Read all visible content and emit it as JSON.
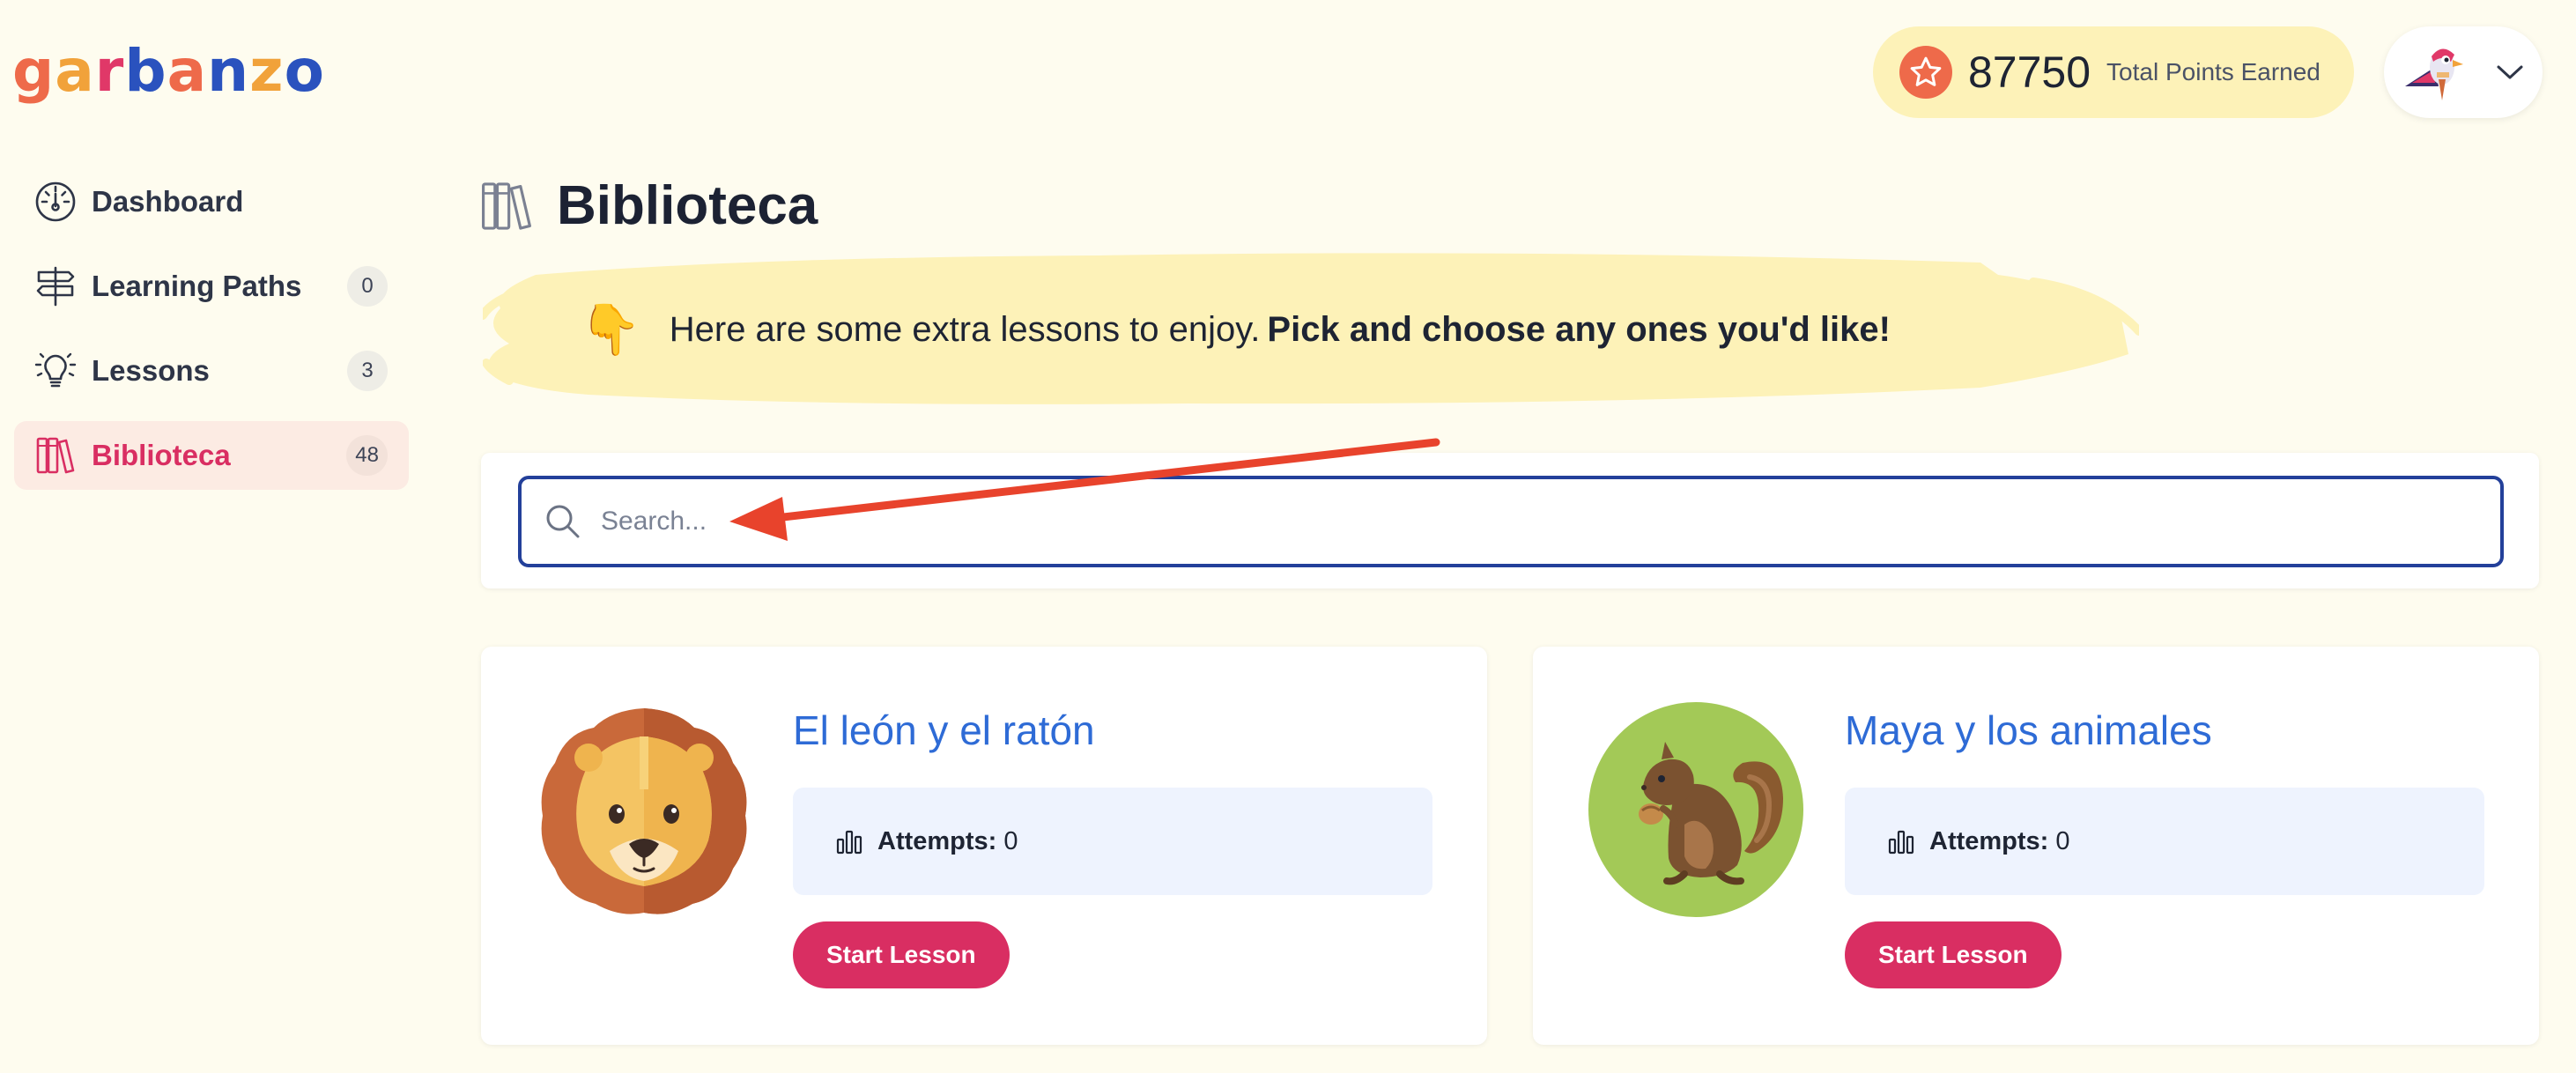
{
  "app": {
    "logo_letters": [
      "g",
      "a",
      "r",
      "b",
      "a",
      "n",
      "z",
      "o"
    ]
  },
  "header": {
    "points_value": "87750",
    "points_label": "Total Points Earned"
  },
  "sidebar": {
    "items": [
      {
        "label": "Dashboard",
        "count": "",
        "icon": "gauge-icon"
      },
      {
        "label": "Learning Paths",
        "count": "0",
        "icon": "signpost-icon"
      },
      {
        "label": "Lessons",
        "count": "3",
        "icon": "lightbulb-icon"
      },
      {
        "label": "Biblioteca",
        "count": "48",
        "icon": "books-icon",
        "active": true
      }
    ]
  },
  "page": {
    "title": "Biblioteca",
    "banner_text": "Here are some extra lessons to enjoy.",
    "banner_bold": "Pick and choose any ones you'd like!"
  },
  "search": {
    "placeholder": "Search...",
    "value": ""
  },
  "lessons": [
    {
      "title": "El león y el ratón",
      "attempts_label": "Attempts:",
      "attempts_value": "0",
      "button": "Start Lesson",
      "image": "lion-icon"
    },
    {
      "title": "Maya y los animales",
      "attempts_label": "Attempts:",
      "attempts_value": "0",
      "button": "Start Lesson",
      "image": "squirrel-icon"
    }
  ],
  "colors": {
    "background": "#fefcef",
    "accent": "#d92e62",
    "link_blue": "#2e6bd6",
    "banner_yellow": "#fdf2b8",
    "annotation_red": "#e8432c"
  }
}
